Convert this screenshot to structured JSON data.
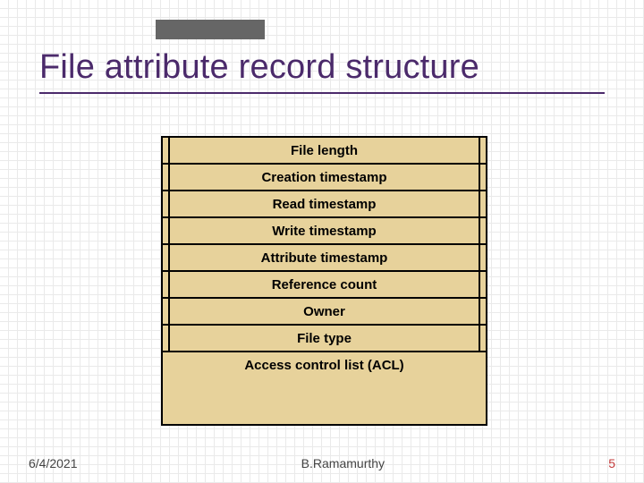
{
  "title": "File attribute record structure",
  "rows": [
    "File length",
    "Creation timestamp",
    "Read timestamp",
    "Write timestamp",
    "Attribute timestamp",
    "Reference count",
    "Owner",
    "File type",
    "Access control list (ACL)"
  ],
  "footer": {
    "date": "6/4/2021",
    "author": "B.Ramamurthy",
    "page": "5"
  }
}
